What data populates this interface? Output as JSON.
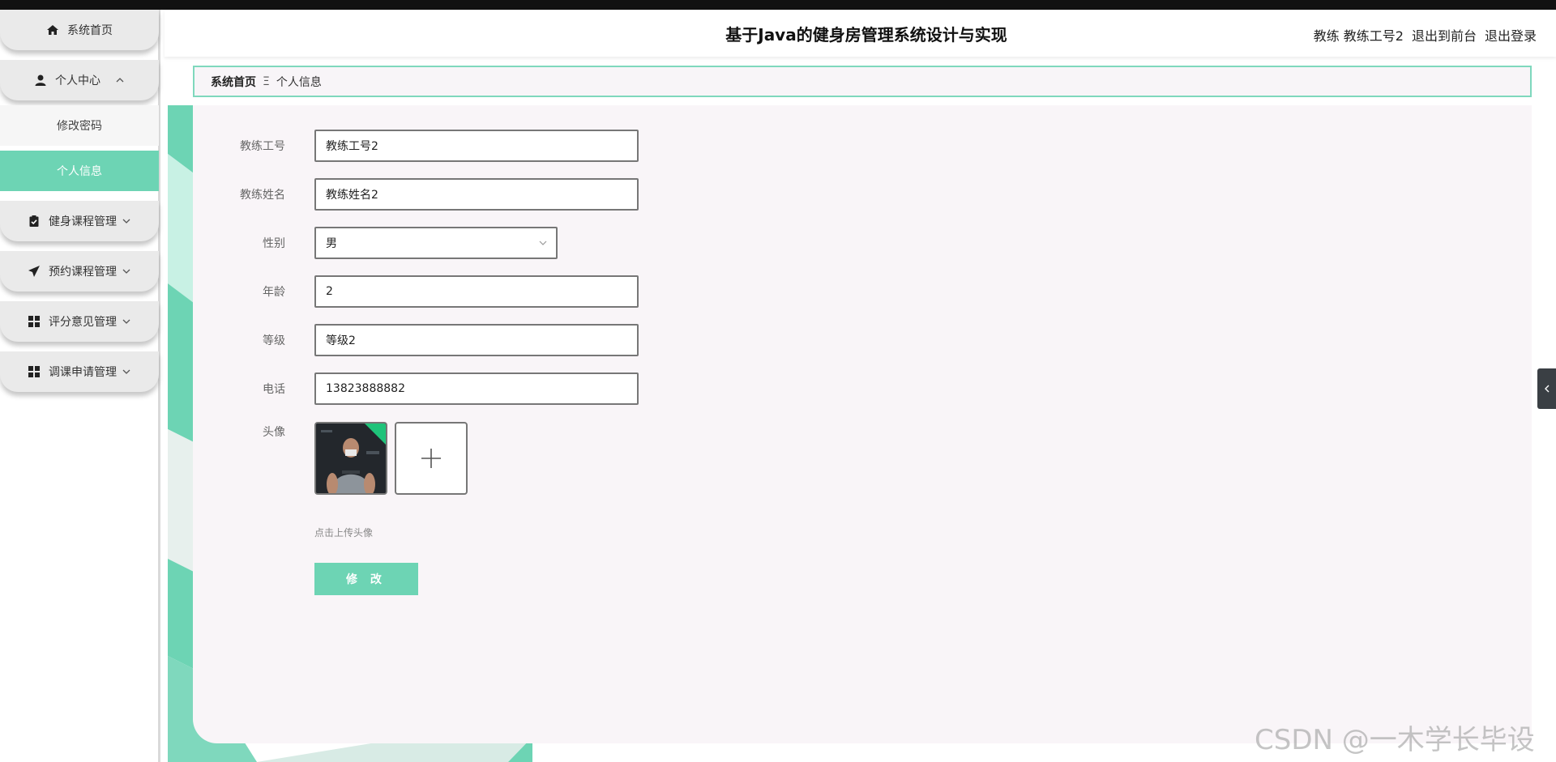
{
  "colors": {
    "accent": "#6dd4b4",
    "breadcrumb_border": "#7fd8bd",
    "card_bg": "#f9f5f8"
  },
  "sidebar": {
    "items": [
      {
        "label": "系统首页",
        "icon": "home-icon"
      },
      {
        "label": "个人中心",
        "icon": "user-icon",
        "expanded": true,
        "children": [
          {
            "label": "修改密码"
          },
          {
            "label": "个人信息",
            "active": true
          }
        ]
      },
      {
        "label": "健身课程管理",
        "icon": "clipboard-icon"
      },
      {
        "label": "预约课程管理",
        "icon": "send-icon"
      },
      {
        "label": "评分意见管理",
        "icon": "grid-icon"
      },
      {
        "label": "调课申请管理",
        "icon": "grid-icon"
      }
    ]
  },
  "header": {
    "title": "基于Java的健身房管理系统设计与实现",
    "user": "教练 教练工号2",
    "to_front": "退出到前台",
    "logout": "退出登录"
  },
  "breadcrumb": {
    "home": "系统首页",
    "separator": "Ξ",
    "current": "个人信息"
  },
  "form": {
    "fields": [
      {
        "label": "教练工号",
        "value": "教练工号2"
      },
      {
        "label": "教练姓名",
        "value": "教练姓名2"
      },
      {
        "label": "性别",
        "value": "男",
        "type": "select"
      },
      {
        "label": "年龄",
        "value": "2"
      },
      {
        "label": "等级",
        "value": "等级2"
      },
      {
        "label": "电话",
        "value": "13823888882"
      }
    ],
    "avatar_label": "头像",
    "upload_hint": "点击上传头像",
    "submit": "修 改"
  },
  "watermark": "CSDN @一木学长毕设"
}
